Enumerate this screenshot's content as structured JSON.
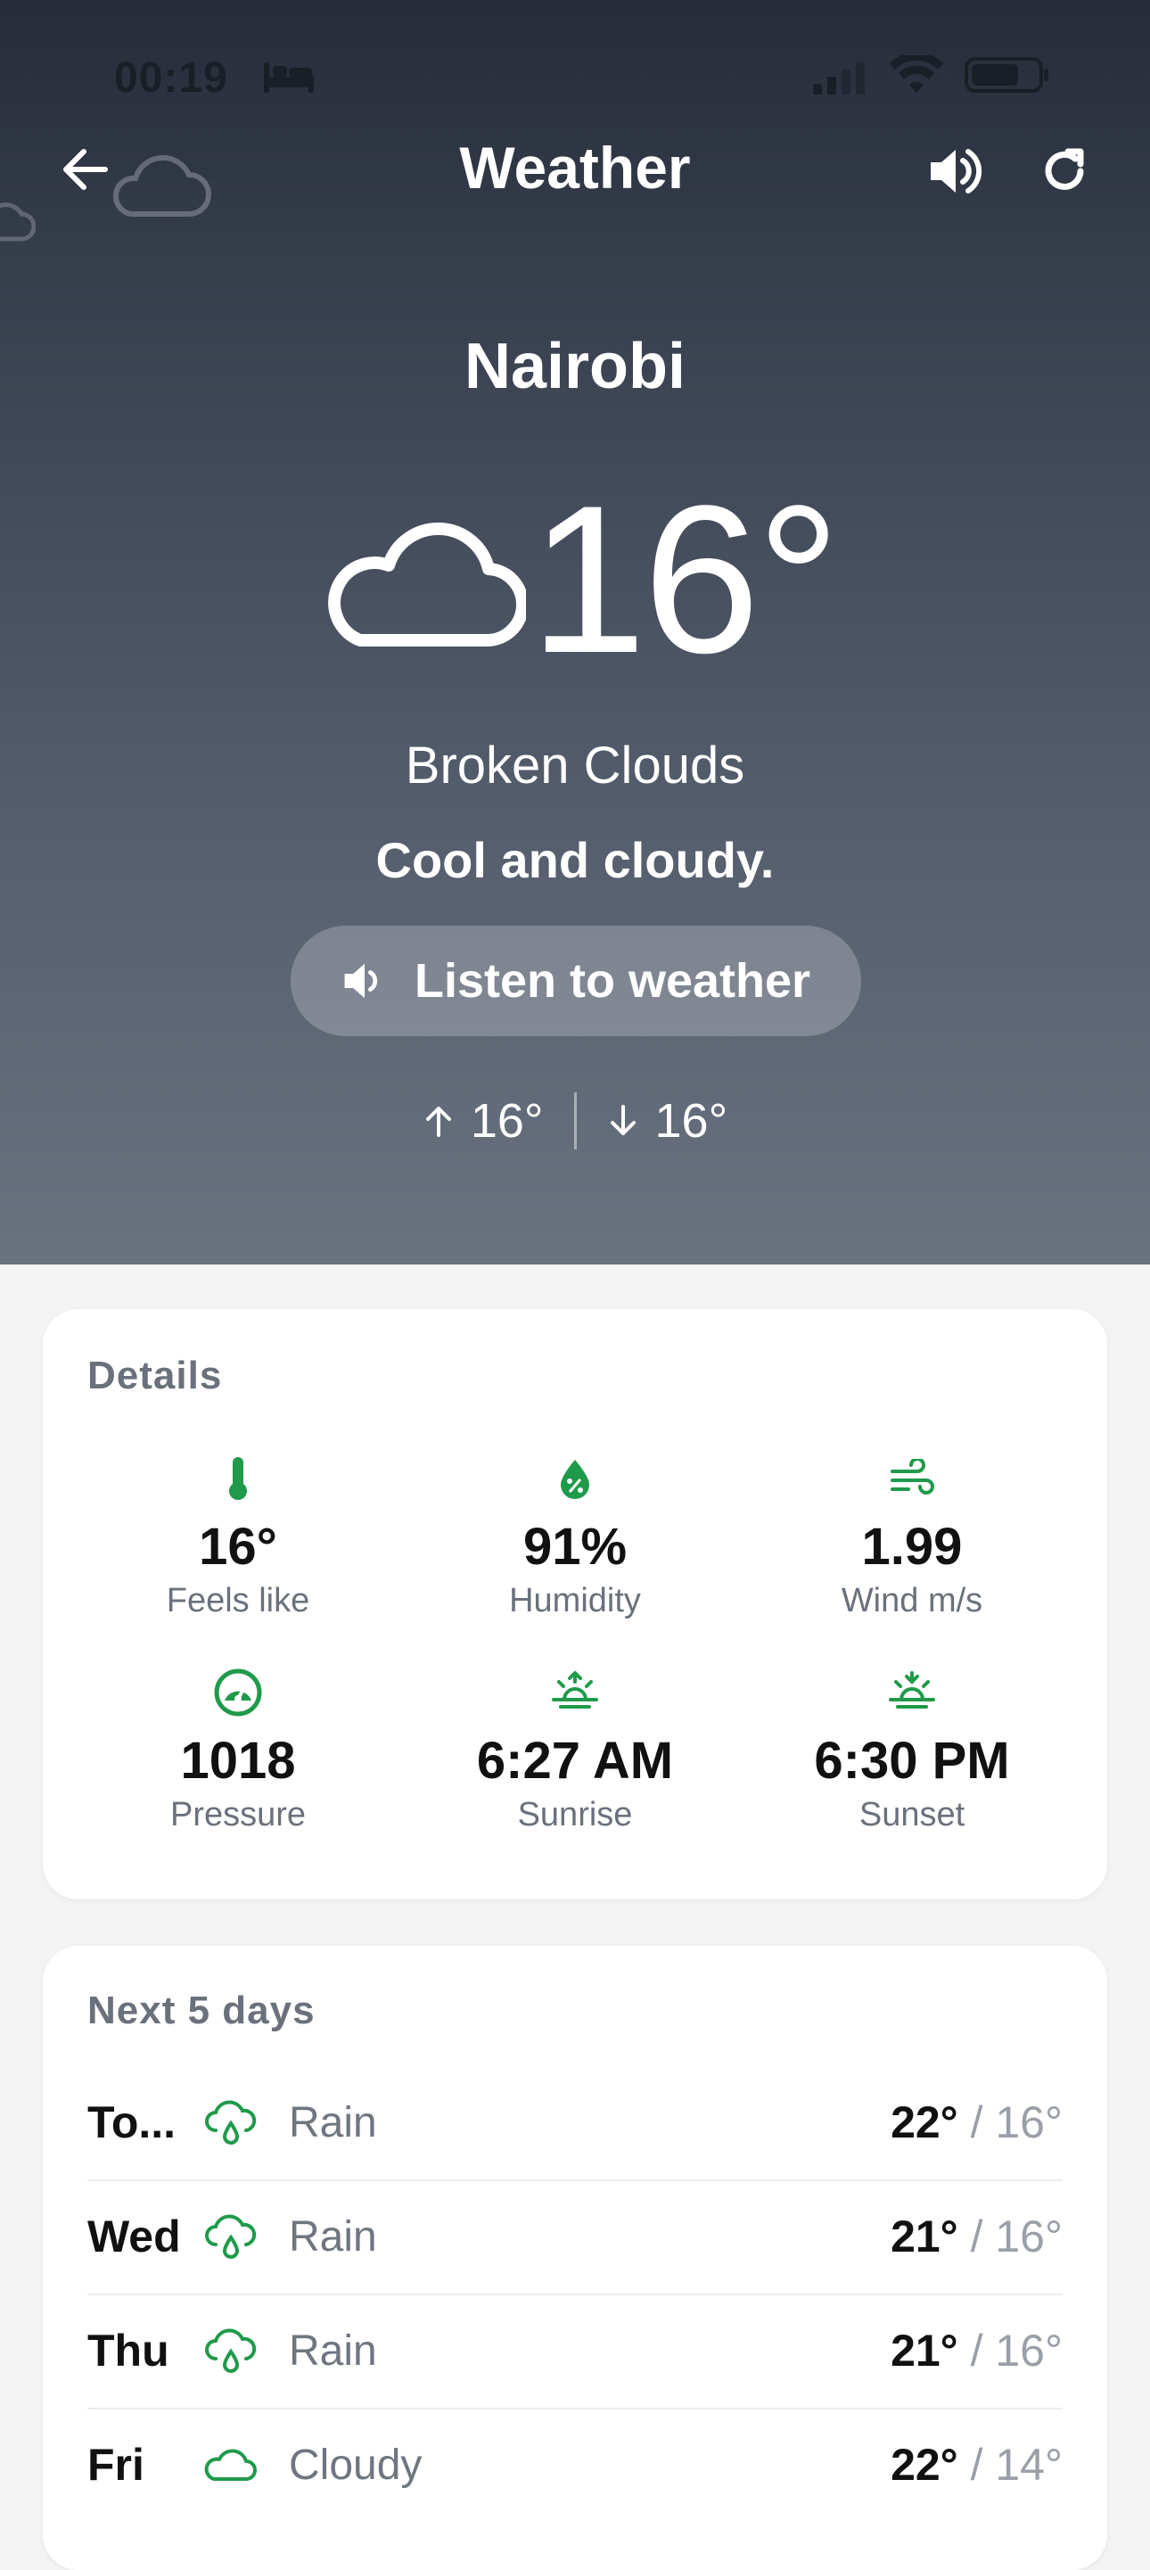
{
  "status_bar": {
    "time": "00:19"
  },
  "header": {
    "title": "Weather"
  },
  "current": {
    "city": "Nairobi",
    "temperature": "16°",
    "condition": "Broken Clouds",
    "summary": "Cool and cloudy.",
    "listen_label": "Listen to weather",
    "high": "16°",
    "low": "16°"
  },
  "details": {
    "heading": "Details",
    "items": [
      {
        "icon": "thermometer-icon",
        "value": "16°",
        "label": "Feels like"
      },
      {
        "icon": "humidity-icon",
        "value": "91%",
        "label": "Humidity"
      },
      {
        "icon": "wind-icon",
        "value": "1.99",
        "label": "Wind m/s"
      },
      {
        "icon": "pressure-gauge-icon",
        "value": "1018",
        "label": "Pressure"
      },
      {
        "icon": "sunrise-icon",
        "value": "6:27 AM",
        "label": "Sunrise"
      },
      {
        "icon": "sunset-icon",
        "value": "6:30 PM",
        "label": "Sunset"
      }
    ]
  },
  "forecast": {
    "heading": "Next 5 days",
    "days": [
      {
        "day": "To...",
        "icon": "rain-cloud-icon",
        "condition": "Rain",
        "high": "22°",
        "low": "/ 16°"
      },
      {
        "day": "Wed",
        "icon": "rain-cloud-icon",
        "condition": "Rain",
        "high": "21°",
        "low": "/ 16°"
      },
      {
        "day": "Thu",
        "icon": "rain-cloud-icon",
        "condition": "Rain",
        "high": "21°",
        "low": "/ 16°"
      },
      {
        "day": "Fri",
        "icon": "cloud-icon",
        "condition": "Cloudy",
        "high": "22°",
        "low": "/ 14°"
      }
    ]
  },
  "colors": {
    "accent": "#1f9a4a",
    "hero_top": "#262c38",
    "hero_bottom": "#6a7280"
  }
}
